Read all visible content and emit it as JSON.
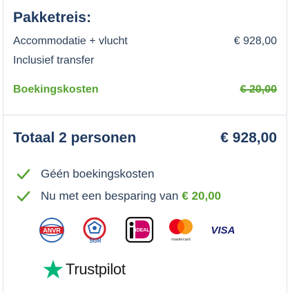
{
  "package": {
    "heading": "Pakketreis:",
    "lines": [
      {
        "label": "Accommodatie + vlucht",
        "value": "€ 928,00"
      },
      {
        "label": "Inclusief transfer",
        "value": ""
      }
    ],
    "booking_costs": {
      "label": "Boekingskosten",
      "value": "€ 20,00"
    }
  },
  "total": {
    "label": "Totaal 2 personen",
    "value": "€ 928,00"
  },
  "benefits": [
    {
      "text": "Géén boekingskosten",
      "amount": ""
    },
    {
      "text": "Nu met een besparing van",
      "amount": "€ 20,00"
    }
  ],
  "payment_logos": [
    {
      "name": "anvr-logo",
      "text": "ANVR"
    },
    {
      "name": "sgr-logo",
      "text": "SGR"
    },
    {
      "name": "ideal-logo",
      "text": "iDEAL"
    },
    {
      "name": "mastercard-logo",
      "text": "mastercard"
    },
    {
      "name": "visa-logo",
      "text": "VISA"
    }
  ],
  "trustpilot": {
    "label": "Trustpilot"
  },
  "colors": {
    "navy": "#1f3a60",
    "green": "#55a22f",
    "trustpilot_green": "#00b67a"
  }
}
